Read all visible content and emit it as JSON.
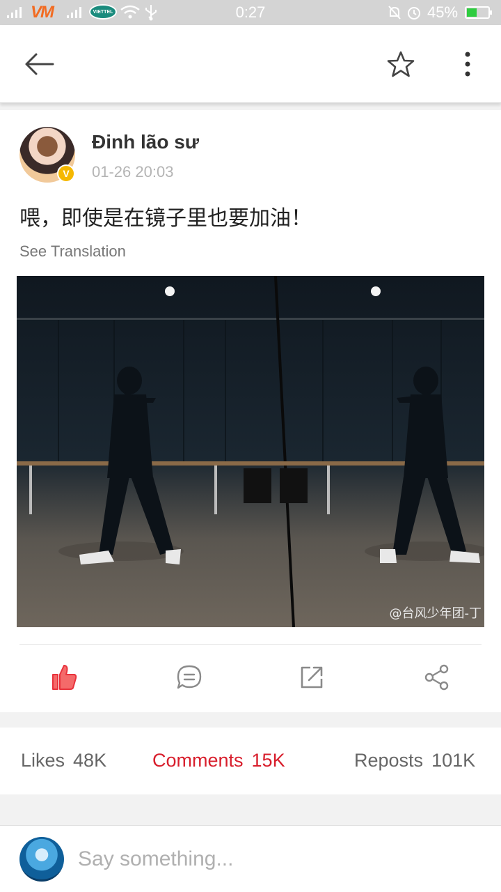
{
  "status_bar": {
    "carrier_1": "VM",
    "carrier_2": "VIETTEL",
    "time": "0:27",
    "battery_pct": "45%",
    "battery_level": 0.45
  },
  "post": {
    "author": "Đinh lão sư",
    "timestamp": "01-26 20:03",
    "text": "喂，即使是在镜子里也要加油！",
    "see_translation": "See Translation",
    "watermark": "@台风少年团-丁"
  },
  "actions": {
    "like_icon": "thumbs-up-icon",
    "comment_icon": "comment-icon",
    "repost_icon": "repost-icon",
    "share_icon": "share-icon",
    "like_color": "#e8323c"
  },
  "stats": {
    "likes_label": "Likes",
    "likes_count": "48K",
    "comments_label": "Comments",
    "comments_count": "15K",
    "reposts_label": "Reposts",
    "reposts_count": "101K",
    "active_color": "#d81e2c"
  },
  "comment": {
    "placeholder": "Say something..."
  }
}
